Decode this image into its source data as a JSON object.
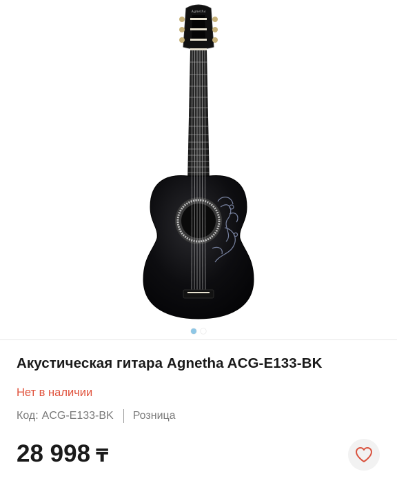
{
  "product": {
    "title": "Акустическая гитара Agnetha ACG-E133-BK",
    "availability": "Нет в наличии",
    "code_label": "Код:",
    "code": "ACG-E133-BK",
    "channel": "Розница",
    "price": "28 998",
    "currency": "₸"
  },
  "gallery": {
    "total_images": 2,
    "active_index": 0,
    "image_subject": "black acoustic guitar",
    "headstock_brand": "Agnetha"
  },
  "icons": {
    "wishlist": "heart-outline-icon"
  },
  "colors": {
    "availability": "#e0523c",
    "active_dot": "#8ec7e6",
    "heart": "#d9533f"
  }
}
